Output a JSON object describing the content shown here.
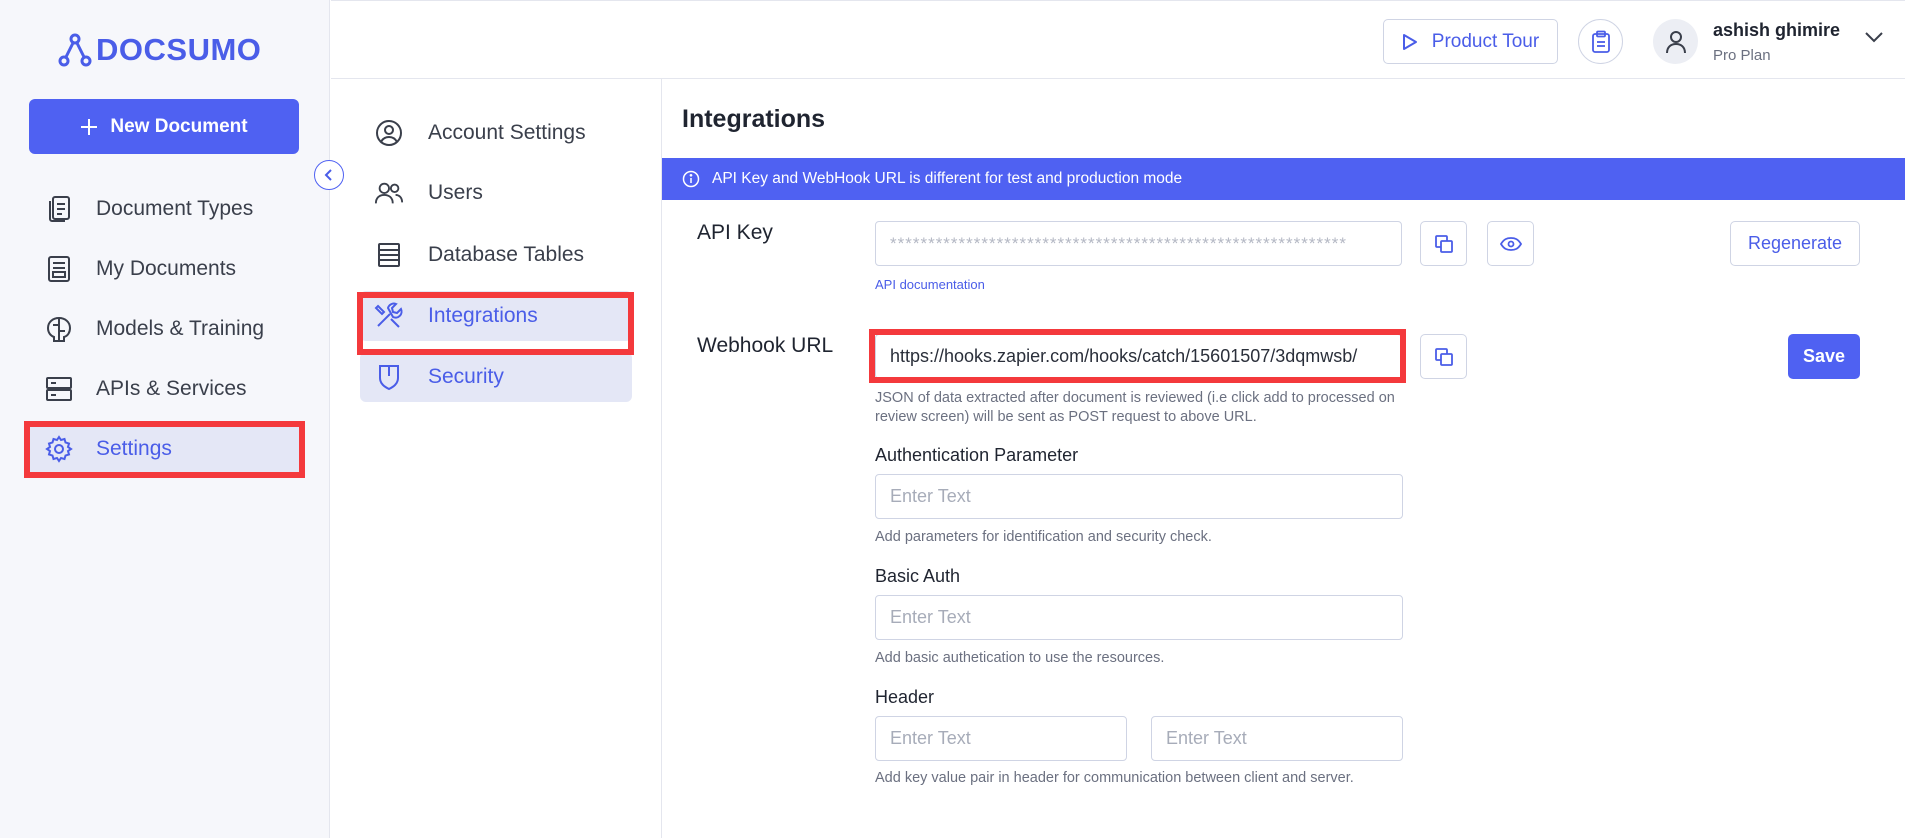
{
  "brand": {
    "name": "DOCSUMO",
    "color": "#4a5de8"
  },
  "sidebar": {
    "new_document_label": "New Document",
    "items": [
      {
        "label": "Document Types",
        "icon": "document-types-icon"
      },
      {
        "label": "My Documents",
        "icon": "my-documents-icon"
      },
      {
        "label": "Models & Training",
        "icon": "brain-icon"
      },
      {
        "label": "APIs & Services",
        "icon": "server-icon"
      },
      {
        "label": "Settings",
        "icon": "gear-icon",
        "active": true
      }
    ]
  },
  "topbar": {
    "product_tour_label": "Product Tour",
    "user_name": "ashish ghimire",
    "user_plan": "Pro Plan"
  },
  "settings_nav": {
    "items": [
      {
        "label": "Account Settings",
        "icon": "user-circle-icon"
      },
      {
        "label": "Users",
        "icon": "users-icon"
      },
      {
        "label": "Database Tables",
        "icon": "table-icon"
      },
      {
        "label": "Integrations",
        "icon": "tools-icon",
        "active": true
      },
      {
        "label": "Security",
        "icon": "shield-icon"
      }
    ]
  },
  "main": {
    "title": "Integrations",
    "banner_text": "API Key and WebHook URL is different for test and production mode",
    "api_key": {
      "label": "API Key",
      "value": "************************************************************",
      "doc_link": "API documentation",
      "regenerate_label": "Regenerate"
    },
    "webhook": {
      "label": "Webhook URL",
      "value": "https://hooks.zapier.com/hooks/catch/15601507/3dqmwsb/",
      "help": "JSON of data extracted after document is reviewed (i.e click add to processed on review screen) will be sent as POST request to above URL.",
      "save_label": "Save"
    },
    "auth_param": {
      "label": "Authentication Parameter",
      "placeholder": "Enter Text",
      "help": "Add parameters for identification and security check."
    },
    "basic_auth": {
      "label": "Basic Auth",
      "placeholder": "Enter Text",
      "help": "Add basic authetication to use the resources."
    },
    "header": {
      "label": "Header",
      "key_placeholder": "Enter Text",
      "value_placeholder": "Enter Text",
      "help": "Add key value pair in header for communication between client and server."
    }
  },
  "colors": {
    "accent": "#4f61f2",
    "highlight_border": "#f4393c",
    "active_bg": "#e4e7f6"
  }
}
